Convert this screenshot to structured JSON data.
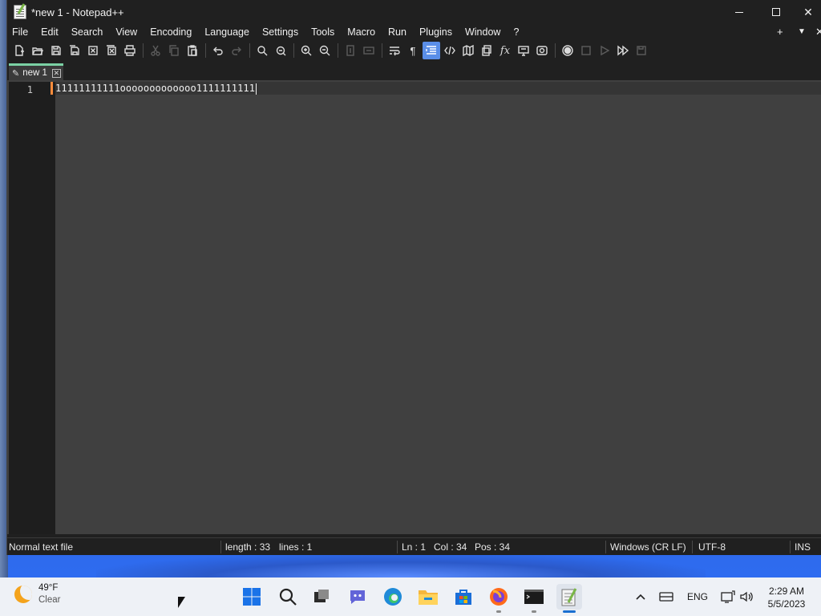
{
  "window": {
    "title": "*new 1 - Notepad++"
  },
  "menubar": {
    "items": [
      "File",
      "Edit",
      "Search",
      "View",
      "Encoding",
      "Language",
      "Settings",
      "Tools",
      "Macro",
      "Run",
      "Plugins",
      "Window",
      "?"
    ],
    "right_controls": [
      "+",
      "▼",
      "✕"
    ]
  },
  "toolbar": {
    "buttons": [
      {
        "name": "new-file-icon",
        "enabled": true
      },
      {
        "name": "open-file-icon",
        "enabled": true
      },
      {
        "name": "save-icon",
        "enabled": true
      },
      {
        "name": "save-all-icon",
        "enabled": true
      },
      {
        "name": "close-icon",
        "enabled": true
      },
      {
        "name": "close-all-icon",
        "enabled": true
      },
      {
        "name": "print-icon",
        "enabled": true
      },
      {
        "name": "cut-icon",
        "enabled": false
      },
      {
        "name": "copy-icon",
        "enabled": false
      },
      {
        "name": "paste-icon",
        "enabled": true
      },
      {
        "name": "undo-icon",
        "enabled": true
      },
      {
        "name": "redo-icon",
        "enabled": false
      },
      {
        "name": "find-icon",
        "enabled": true
      },
      {
        "name": "replace-icon",
        "enabled": true
      },
      {
        "name": "zoom-in-icon",
        "enabled": true
      },
      {
        "name": "zoom-out-icon",
        "enabled": true
      },
      {
        "name": "sync-vertical-icon",
        "enabled": false
      },
      {
        "name": "sync-horizontal-icon",
        "enabled": false
      },
      {
        "name": "word-wrap-icon",
        "enabled": true
      },
      {
        "name": "show-all-chars-icon",
        "enabled": true
      },
      {
        "name": "indent-guide-icon",
        "enabled": true,
        "active": true
      },
      {
        "name": "udl-icon",
        "enabled": true
      },
      {
        "name": "document-map-icon",
        "enabled": true
      },
      {
        "name": "document-list-icon",
        "enabled": true
      },
      {
        "name": "function-list-icon",
        "enabled": true
      },
      {
        "name": "folder-workspace-icon",
        "enabled": true
      },
      {
        "name": "monitoring-icon",
        "enabled": true
      },
      {
        "name": "record-macro-icon",
        "enabled": true
      },
      {
        "name": "stop-record-icon",
        "enabled": false
      },
      {
        "name": "playback-icon",
        "enabled": false
      },
      {
        "name": "run-macro-multiple-icon",
        "enabled": true
      },
      {
        "name": "save-macro-icon",
        "enabled": false
      }
    ]
  },
  "tabs": [
    {
      "label": "new 1",
      "close": "✕"
    }
  ],
  "editor": {
    "line_numbers": [
      "1"
    ],
    "lines": [
      "11111111111ooooooooooooo1111111111"
    ]
  },
  "statusbar": {
    "file_type": "Normal text file",
    "length": "length : 33",
    "lines": "lines : 1",
    "ln": "Ln : 1",
    "col": "Col : 34",
    "pos": "Pos : 34",
    "eol": "Windows (CR LF)",
    "encoding": "UTF-8",
    "mode": "INS"
  },
  "taskbar": {
    "weather_temp": "49°F",
    "weather_condition": "Clear",
    "language": "ENG",
    "time": "2:29 AM",
    "date": "5/5/2023",
    "apps": [
      "start-icon",
      "search-icon",
      "task-view-icon",
      "teams-chat-icon",
      "edge-icon",
      "file-explorer-icon",
      "store-icon",
      "firefox-icon",
      "terminal-icon",
      "notepadpp-icon"
    ]
  },
  "colors": {
    "editor_bg": "#404040",
    "gutter_bg": "#1e1e1e",
    "tab_accent": "#7bd1a4",
    "caret_marker": "#ff8c3c",
    "toolbar_active": "#5a8ee8"
  }
}
